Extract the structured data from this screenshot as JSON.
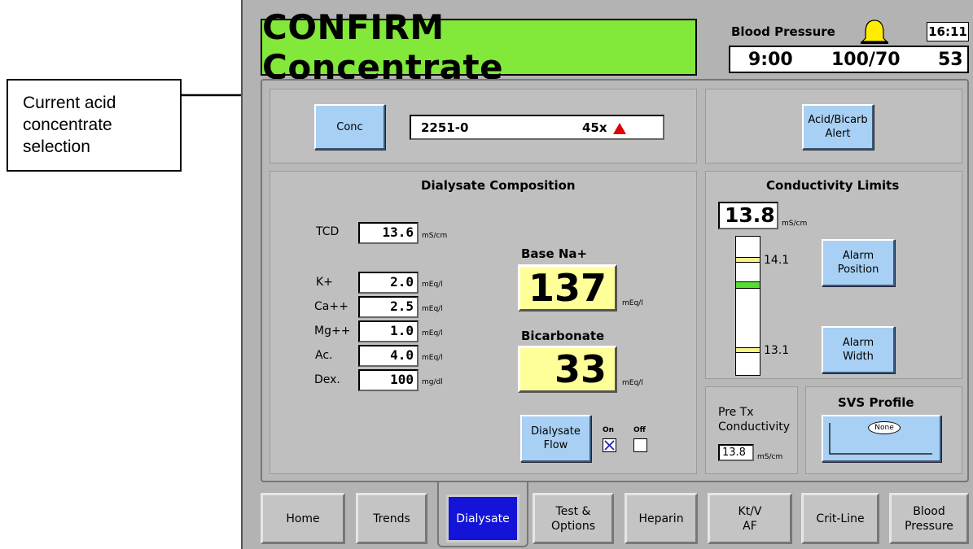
{
  "callout": {
    "lines": [
      "Current acid",
      "concentrate",
      "selection"
    ]
  },
  "header": {
    "title": "CONFIRM Concentrate",
    "bp_label": "Blood Pressure",
    "clock": "16:11",
    "bp_time": "9:00",
    "bp_value": "100/70",
    "bp_pulse": "53"
  },
  "conc": {
    "button": "Conc",
    "code": "2251-0",
    "factor": "45x",
    "alert_button_line1": "Acid/Bicarb",
    "alert_button_line2": "Alert"
  },
  "composition": {
    "heading": "Dialysate Composition",
    "tcd": {
      "label": "TCD",
      "value": "13.6",
      "unit": "mS/cm"
    },
    "rows": [
      {
        "label": "K+",
        "value": "2.0",
        "unit": "mEq/l"
      },
      {
        "label": "Ca++",
        "value": "2.5",
        "unit": "mEq/l"
      },
      {
        "label": "Mg++",
        "value": "1.0",
        "unit": "mEq/l"
      },
      {
        "label": "Ac.",
        "value": "4.0",
        "unit": "mEq/l"
      },
      {
        "label": "Dex.",
        "value": "100",
        "unit": "mg/dl"
      }
    ],
    "base_na": {
      "label": "Base Na+",
      "value": "137",
      "unit": "mEq/l"
    },
    "bicarb": {
      "label": "Bicarbonate",
      "value": "33",
      "unit": "mEq/l"
    },
    "flow": {
      "line1": "Dialysate",
      "line2": "Flow",
      "on_label": "On",
      "off_label": "Off",
      "on_checked": true
    }
  },
  "conductivity": {
    "heading": "Conductivity Limits",
    "value": "13.8",
    "unit": "mS/cm",
    "upper": "14.1",
    "lower": "13.1",
    "alarm_position": [
      "Alarm",
      "Position"
    ],
    "alarm_width": [
      "Alarm",
      "Width"
    ]
  },
  "pretx": {
    "line1": "Pre Tx",
    "line2": "Conductivity",
    "value": "13.8",
    "unit": "mS/cm"
  },
  "svs": {
    "heading": "SVS Profile",
    "badge": "None"
  },
  "tabs": [
    {
      "line1": "Home",
      "line2": ""
    },
    {
      "line1": "Trends",
      "line2": ""
    },
    {
      "line1": "Dialysate",
      "line2": ""
    },
    {
      "line1": "Test &",
      "line2": "Options"
    },
    {
      "line1": "Heparin",
      "line2": ""
    },
    {
      "line1": "Kt/V",
      "line2": "AF"
    },
    {
      "line1": "Crit-Line",
      "line2": ""
    },
    {
      "line1": "Blood",
      "line2": "Pressure"
    }
  ],
  "colors": {
    "title_bg": "#82e83a",
    "button": "#a8d0f4",
    "readout": "#ffff99",
    "active_tab": "#1414d8",
    "alert": "#e00000"
  }
}
